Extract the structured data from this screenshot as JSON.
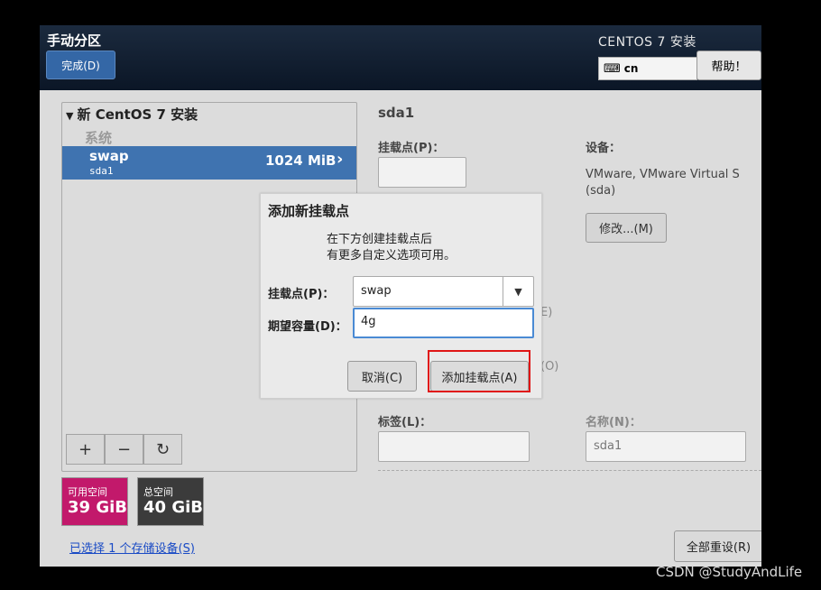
{
  "header": {
    "title": "手动分区",
    "done_label": "完成(D)",
    "os_title": "CENTOS 7 安装",
    "keyboard_layout": "cn",
    "help_label": "帮助！"
  },
  "left_panel": {
    "root_label": "新 CentOS 7 安装",
    "group_label": "系统",
    "selected_item": {
      "name": "swap",
      "device": "sda1",
      "size": "1024 MiB"
    },
    "toolbar": {
      "add": "+",
      "remove": "−",
      "refresh": "↻"
    }
  },
  "space": {
    "available_label": "可用空间",
    "available_value": "39 GiB",
    "total_label": "总空间",
    "total_value": "40 GiB",
    "available_color": "#c2196b"
  },
  "storage_link": "已选择 1 个存储设备(S)",
  "right_panel": {
    "title": "sda1",
    "mount_label": "挂载点(P)：",
    "device_label": "设备：",
    "device_value": "VMware, VMware Virtual S (sda)",
    "modify_label": "修改...(M)",
    "partial_e": "E)",
    "partial_o": "(O)",
    "tag_label": "标签(L)：",
    "name_label": "名称(N)：",
    "name_value": "sda1",
    "reset_label": "全部重设(R)"
  },
  "dialog": {
    "title": "添加新挂载点",
    "desc_line1": "在下方创建挂载点后",
    "desc_line2": "有更多自定义选项可用。",
    "mount_label": "挂载点(P)：",
    "mount_value": "swap",
    "capacity_label": "期望容量(D)：",
    "capacity_value": "4g",
    "cancel_label": "取消(C)",
    "add_label": "添加挂载点(A)"
  },
  "watermark": "CSDN @StudyAndLife"
}
